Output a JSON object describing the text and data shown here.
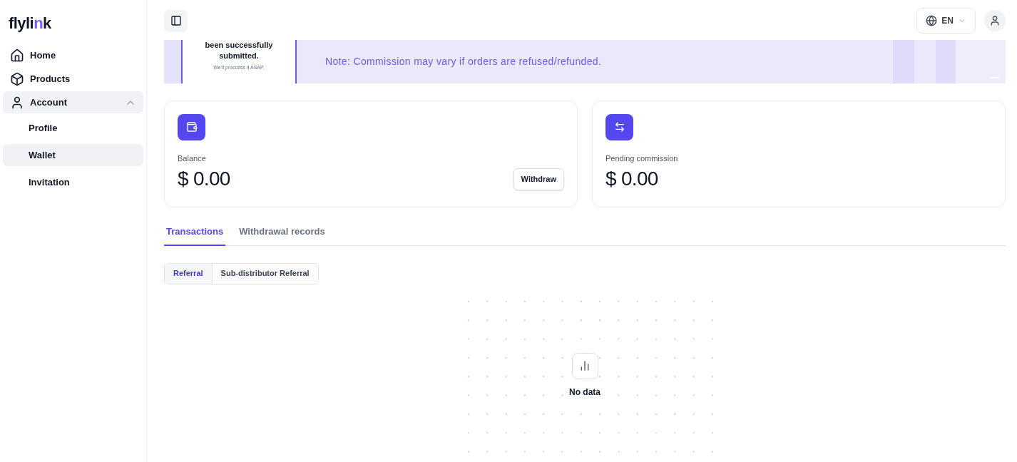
{
  "logo": {
    "before": "flyli",
    "mark": "n",
    "after": "k"
  },
  "sidebar": {
    "items": [
      {
        "label": "Home",
        "selected": false
      },
      {
        "label": "Products",
        "selected": false
      },
      {
        "label": "Account",
        "expanded": true,
        "children": [
          {
            "label": "Profile",
            "selected": false
          },
          {
            "label": "Wallet",
            "selected": true
          },
          {
            "label": "Invitation",
            "selected": false
          }
        ]
      }
    ]
  },
  "header": {
    "language": "EN"
  },
  "banner": {
    "title": "been successfully submitted.",
    "subtitle": "We'll proccess it ASAP.",
    "note": "Note: Commission may vary if orders are refused/refunded."
  },
  "cards": [
    {
      "label": "Balance",
      "value": "$ 0.00",
      "button": "Withdraw"
    },
    {
      "label": "Pending commission",
      "value": "$ 0.00"
    }
  ],
  "tabs": [
    {
      "label": "Transactions",
      "selected": true
    },
    {
      "label": "Withdrawal records",
      "selected": false
    }
  ],
  "segments": [
    {
      "label": "Referral",
      "selected": true
    },
    {
      "label": "Sub-distributor Referral",
      "selected": false
    }
  ],
  "empty_state": {
    "text": "No data"
  }
}
